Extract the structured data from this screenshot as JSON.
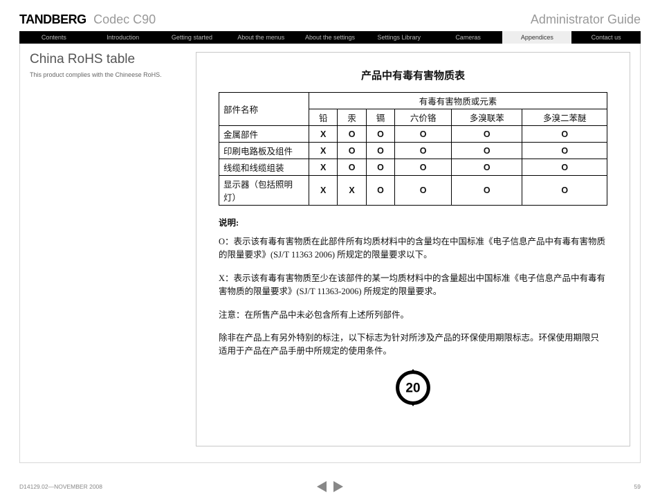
{
  "header": {
    "brand": "TANDBERG",
    "model": "Codec C90",
    "doc_title": "Administrator Guide"
  },
  "nav": {
    "tabs": [
      {
        "label": "Contents"
      },
      {
        "label": "Introduction"
      },
      {
        "label": "Getting started"
      },
      {
        "label": "About the menus"
      },
      {
        "label": "About the settings"
      },
      {
        "label": "Settings Library"
      },
      {
        "label": "Cameras"
      },
      {
        "label": "Appendices",
        "active": true
      },
      {
        "label": "Contact us"
      }
    ]
  },
  "section": {
    "title": "China RoHS table",
    "subtitle": "This product complies with the Chineese RoHS."
  },
  "rohs": {
    "title": "产品中有毒有害物质表",
    "part_header": "部件名称",
    "group_header": "有毒有害物质或元素",
    "columns": [
      "铅",
      "汞",
      "镉",
      "六价铬",
      "多溴联苯",
      "多溴二苯醚"
    ],
    "rows": [
      {
        "name": "金属部件",
        "v": [
          "X",
          "O",
          "O",
          "O",
          "O",
          "O"
        ]
      },
      {
        "name": "印刷电路板及组件",
        "v": [
          "X",
          "O",
          "O",
          "O",
          "O",
          "O"
        ]
      },
      {
        "name": "线缆和线缆组装",
        "v": [
          "X",
          "O",
          "O",
          "O",
          "O",
          "O"
        ]
      },
      {
        "name": "显示器（包括照明灯）",
        "v": [
          "X",
          "X",
          "O",
          "O",
          "O",
          "O"
        ]
      }
    ],
    "explain_head": "说明:",
    "para_o": "O：表示该有毒有害物质在此部件所有均质材料中的含量均在中国标准《电子信息产品中有毒有害物质的限量要求》(SJ/T 11363 2006) 所规定的限量要求以下。",
    "para_x": "X：表示该有毒有害物质至少在该部件的某一均质材料中的含量超出中国标准《电子信息产品中有毒有害物质的限量要求》(SJ/T 11363-2006) 所规定的限量要求。",
    "para_note": "注意：在所售产品中未必包含所有上述所列部件。",
    "para_env": "除非在产品上有另外特别的标注，以下标志为针对所涉及产品的环保使用期限标志。环保使用期限只适用于产品在产品手册中所规定的使用条件。",
    "env_years": "20"
  },
  "footer": {
    "docref": "D14129.02—NOVEMBER 2008",
    "page": "59"
  }
}
